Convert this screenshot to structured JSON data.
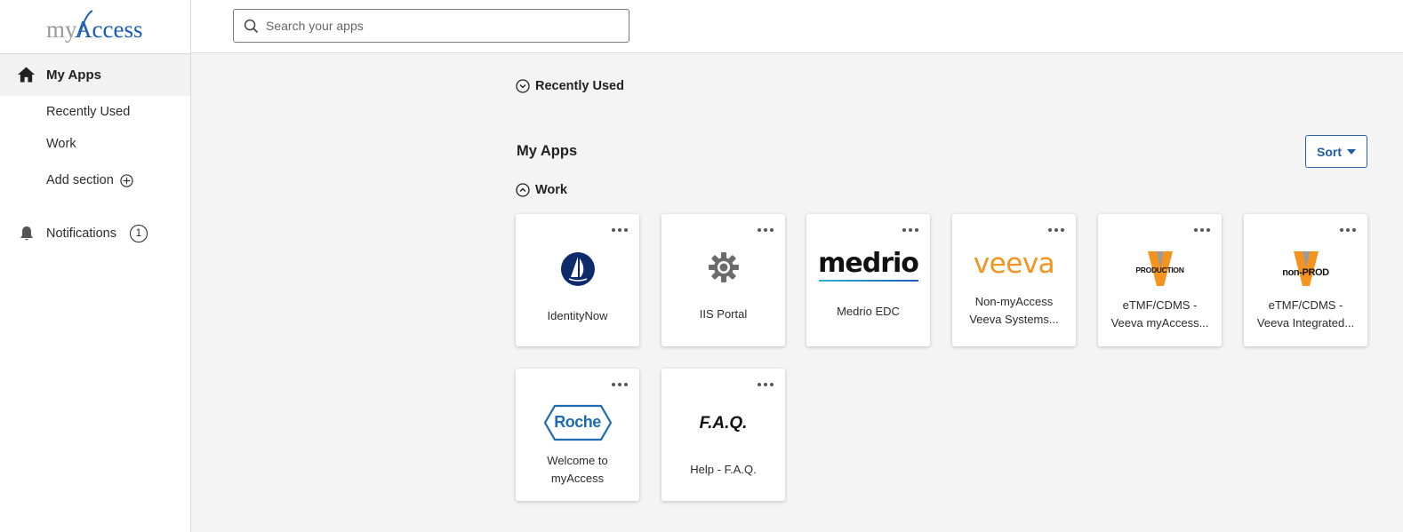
{
  "brand": {
    "logo_text_prefix": "my",
    "logo_text_main": "Access",
    "logo_color": "#1a5db5",
    "logo_gray": "#9a9a9a"
  },
  "header": {
    "search_placeholder": "Search your apps"
  },
  "sidebar": {
    "my_apps_label": "My Apps",
    "recently_used_label": "Recently Used",
    "work_label": "Work",
    "add_section_label": "Add section",
    "notifications_label": "Notifications",
    "notifications_count": "1"
  },
  "main": {
    "recently_used_label": "Recently Used",
    "my_apps_title": "My Apps",
    "sort_label": "Sort",
    "work_label": "Work",
    "apps": [
      {
        "name_line1": "IdentityNow",
        "name_line2": "",
        "logo": "sailboat-icon"
      },
      {
        "name_line1": "IIS Portal",
        "name_line2": "",
        "logo": "gear-icon"
      },
      {
        "name_line1": "Medrio EDC",
        "name_line2": "",
        "logo_text": "medrio"
      },
      {
        "name_line1": "Non-myAccess",
        "name_line2": "Veeva Systems...",
        "logo_text": "veeva"
      },
      {
        "name_line1": "eTMF/CDMS -",
        "name_line2": "Veeva myAccess...",
        "logo_text": "PRODUCTION"
      },
      {
        "name_line1": "eTMF/CDMS -",
        "name_line2": "Veeva Integrated...",
        "logo_text": "non-PROD"
      },
      {
        "name_line1": "Welcome to",
        "name_line2": "myAccess",
        "logo_text": "Roche"
      },
      {
        "name_line1": "Help - F.A.Q.",
        "name_line2": "",
        "logo_text": "F.A.Q."
      }
    ]
  },
  "colors": {
    "veeva_orange": "#f5931f",
    "roche_blue": "#1d6bb5",
    "identitynow_navy": "#0d2a6b",
    "accent_blue": "#1f5ca6"
  }
}
